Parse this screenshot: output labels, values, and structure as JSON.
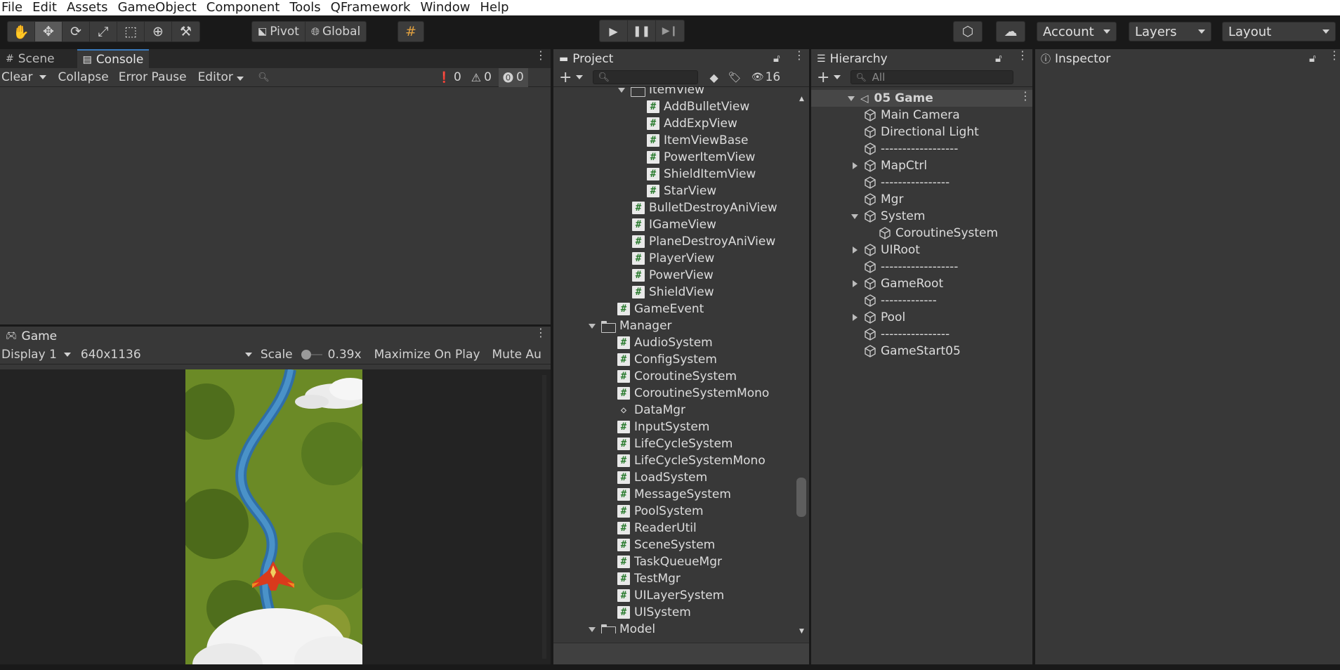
{
  "menu": [
    "File",
    "Edit",
    "Assets",
    "GameObject",
    "Component",
    "Tools",
    "QFramework",
    "Window",
    "Help"
  ],
  "toolbar": {
    "pivot": "Pivot",
    "global": "Global",
    "account": "Account",
    "layers": "Layers",
    "layout": "Layout"
  },
  "scene_panel": {
    "tab_scene": "Scene",
    "tab_console": "Console",
    "clear": "Clear",
    "collapse": "Collapse",
    "error_pause": "Error Pause",
    "editor": "Editor",
    "log_count": "0",
    "warn_count": "0",
    "error_count": "0"
  },
  "game_panel": {
    "tab": "Game",
    "display": "Display 1",
    "resolution": "640x1136",
    "scale_label": "Scale",
    "scale_value": "0.39x",
    "maximize": "Maximize On Play",
    "mute": "Mute Au"
  },
  "project_panel": {
    "tab": "Project",
    "hidden_count": "16",
    "items": [
      {
        "label": "ItemView",
        "kind": "folder",
        "indent": 1
      },
      {
        "label": "AddBulletView",
        "kind": "script",
        "indent": 2
      },
      {
        "label": "AddExpView",
        "kind": "script",
        "indent": 2
      },
      {
        "label": "ItemViewBase",
        "kind": "script",
        "indent": 2
      },
      {
        "label": "PowerItemView",
        "kind": "script",
        "indent": 2
      },
      {
        "label": "ShieldItemView",
        "kind": "script",
        "indent": 2
      },
      {
        "label": "StarView",
        "kind": "script",
        "indent": 2
      },
      {
        "label": "BulletDestroyAniView",
        "kind": "script",
        "indent": 1
      },
      {
        "label": "IGameView",
        "kind": "script",
        "indent": 1
      },
      {
        "label": "PlaneDestroyAniView",
        "kind": "script",
        "indent": 1
      },
      {
        "label": "PlayerView",
        "kind": "script",
        "indent": 1
      },
      {
        "label": "PowerView",
        "kind": "script",
        "indent": 1
      },
      {
        "label": "ShieldView",
        "kind": "script",
        "indent": 1
      },
      {
        "label": "GameEvent",
        "kind": "script",
        "indent": 0
      },
      {
        "label": "Manager",
        "kind": "folder",
        "indent": -1
      },
      {
        "label": "AudioSystem",
        "kind": "script",
        "indent": 0
      },
      {
        "label": "ConfigSystem",
        "kind": "script",
        "indent": 0
      },
      {
        "label": "CoroutineSystem",
        "kind": "script",
        "indent": 0
      },
      {
        "label": "CoroutineSystemMono",
        "kind": "script",
        "indent": 0
      },
      {
        "label": "DataMgr",
        "kind": "other",
        "indent": 0
      },
      {
        "label": "InputSystem",
        "kind": "script",
        "indent": 0
      },
      {
        "label": "LifeCycleSystem",
        "kind": "script",
        "indent": 0
      },
      {
        "label": "LifeCycleSystemMono",
        "kind": "script",
        "indent": 0
      },
      {
        "label": "LoadSystem",
        "kind": "script",
        "indent": 0
      },
      {
        "label": "MessageSystem",
        "kind": "script",
        "indent": 0
      },
      {
        "label": "PoolSystem",
        "kind": "script",
        "indent": 0
      },
      {
        "label": "ReaderUtil",
        "kind": "script",
        "indent": 0
      },
      {
        "label": "SceneSystem",
        "kind": "script",
        "indent": 0
      },
      {
        "label": "TaskQueueMgr",
        "kind": "script",
        "indent": 0
      },
      {
        "label": "TestMgr",
        "kind": "script",
        "indent": 0
      },
      {
        "label": "UILayerSystem",
        "kind": "script",
        "indent": 0
      },
      {
        "label": "UISystem",
        "kind": "script",
        "indent": 0
      },
      {
        "label": "Model",
        "kind": "folder",
        "indent": -1
      }
    ]
  },
  "hierarchy_panel": {
    "tab": "Hierarchy",
    "search_placeholder": "All",
    "scene_name": "05 Game",
    "items": [
      {
        "label": "Main Camera",
        "indent": 0,
        "arrow": "none"
      },
      {
        "label": "Directional Light",
        "indent": 0,
        "arrow": "none"
      },
      {
        "label": "------------------",
        "indent": 0,
        "arrow": "none"
      },
      {
        "label": "MapCtrl",
        "indent": 0,
        "arrow": "right"
      },
      {
        "label": "----------------",
        "indent": 0,
        "arrow": "none"
      },
      {
        "label": "Mgr",
        "indent": 0,
        "arrow": "none"
      },
      {
        "label": "System",
        "indent": 0,
        "arrow": "down"
      },
      {
        "label": "CoroutineSystem",
        "indent": 1,
        "arrow": "none"
      },
      {
        "label": "UIRoot",
        "indent": 0,
        "arrow": "right"
      },
      {
        "label": "------------------",
        "indent": 0,
        "arrow": "none"
      },
      {
        "label": "GameRoot",
        "indent": 0,
        "arrow": "right"
      },
      {
        "label": "-------------",
        "indent": 0,
        "arrow": "none"
      },
      {
        "label": "Pool",
        "indent": 0,
        "arrow": "right"
      },
      {
        "label": "----------------",
        "indent": 0,
        "arrow": "none"
      },
      {
        "label": "GameStart05",
        "indent": 0,
        "arrow": "none"
      }
    ]
  },
  "inspector_panel": {
    "tab": "Inspector"
  },
  "colors": {
    "panel_bg": "#383838",
    "tab_bg": "#282828",
    "accent": "#3a79bb",
    "script_green": "#2e7d32"
  }
}
